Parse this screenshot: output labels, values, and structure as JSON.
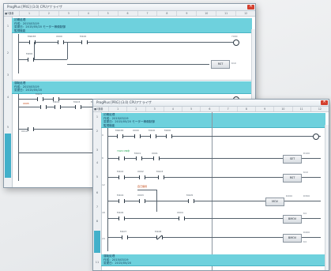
{
  "window_back": {
    "title": "ProgPlus [PRG] (3.0) CPUアナライザ",
    "corner_label": "■3通番",
    "columns": [
      "1",
      "2",
      "3",
      "4",
      "5",
      "6",
      "7",
      "8",
      "9",
      "10",
      "11",
      "12"
    ],
    "row_numbers": [
      "1",
      "2",
      "3",
      "4",
      "5",
      "6",
      "7"
    ],
    "comment1": [
      "初期処理",
      "作成：2015/03/19",
      "変更日：2015/05/20 モーター稼働制御",
      "監視機能"
    ],
    "comment2": [
      "運転処理",
      "作成：2015/03/19",
      "変更日：2015/05/20"
    ],
    "contacts": [
      "M9038",
      "X000",
      "M100",
      "M200",
      "M101",
      "X005",
      "M102",
      "M103",
      "M104",
      "X010",
      "M105"
    ],
    "box_label": "RST",
    "side_labels": [
      "Y000",
      "K10",
      "D100"
    ],
    "step_numbers": [
      "0",
      "8",
      "14",
      "20"
    ]
  },
  "window_front": {
    "title": "ProgPlus [PRG] (3.0) CPUアナライザ",
    "corner_label": "■3通番",
    "columns": [
      "1",
      "2",
      "3",
      "4",
      "5",
      "6",
      "7",
      "8",
      "9",
      "10",
      "11",
      "12"
    ],
    "row_numbers": [
      "1",
      "2",
      "3",
      "4",
      "5",
      "6",
      "7",
      "8",
      "9",
      "10",
      "11",
      "12"
    ],
    "comment1": [
      "初期処理",
      "作成：2015/03/19",
      "変更日：2015/05/20 モーター稼働制御",
      "監視機能"
    ],
    "comment2": [
      "運転処理",
      "作成：2015/03/19",
      "変更日：2015/05/20"
    ],
    "contacts": [
      "M9038",
      "X000",
      "M100",
      "M200",
      "M101",
      "X001",
      "M102",
      "X002",
      "M103",
      "M104",
      "X003",
      "M105",
      "M106",
      "X004",
      "M107",
      "M108"
    ],
    "green_label": "Y020 ON中",
    "orange_label": "自己保持",
    "step_numbers": [
      "0",
      "6",
      "12",
      "18",
      "24",
      "30",
      "36",
      "42"
    ],
    "boxes": [
      "SET",
      "RST",
      "MOV",
      "BMOV",
      "BMOV"
    ],
    "side_labels": [
      "D100",
      "K10",
      "D200",
      "D300",
      "K4",
      "D400",
      "K4"
    ]
  }
}
